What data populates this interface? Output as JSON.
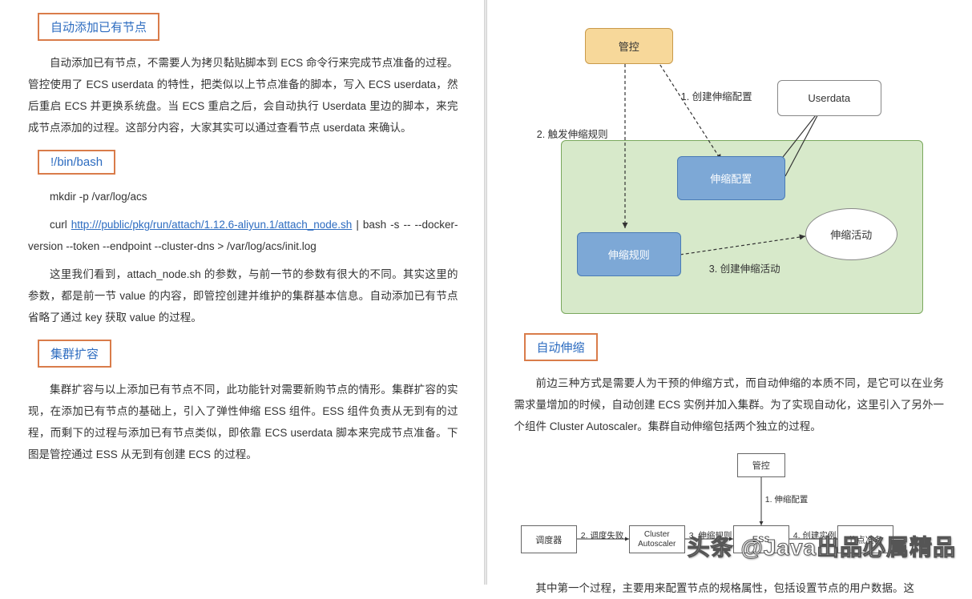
{
  "left": {
    "heading1": "自动添加已有节点",
    "para1": "自动添加已有节点，不需要人为拷贝黏贴脚本到 ECS 命令行来完成节点准备的过程。管控使用了 ECS userdata 的特性，把类似以上节点准备的脚本，写入 ECS userdata，然后重启 ECS 并更换系统盘。当 ECS 重启之后，会自动执行 Userdata 里边的脚本，来完成节点添加的过程。这部分内容，大家其实可以通过查看节点 userdata 来确认。",
    "heading2": "!/bin/bash",
    "code1": "mkdir -p /var/log/acs",
    "code2_prefix": "curl ",
    "code2_link": "http:///public/pkg/run/attach/1.12.6-aliyun.1/attach_node.sh",
    "code2_suffix": " | bash -s -- --docker-version --token --endpoint --cluster-dns > /var/log/acs/init.log",
    "para2": "这里我们看到，attach_node.sh 的参数，与前一节的参数有很大的不同。其实这里的参数，都是前一节 value 的内容，即管控创建并维护的集群基本信息。自动添加已有节点省略了通过 key 获取 value 的过程。",
    "heading3": "集群扩容",
    "para3": "集群扩容与以上添加已有节点不同，此功能针对需要新购节点的情形。集群扩容的实现，在添加已有节点的基础上，引入了弹性伸缩 ESS 组件。ESS 组件负责从无到有的过程，而剩下的过程与添加已有节点类似，即依靠 ECS userdata 脚本来完成节点准备。下图是管控通过 ESS 从无到有创建 ECS 的过程。"
  },
  "right": {
    "diagram_top": {
      "box_control": "管控",
      "box_userdata": "Userdata",
      "box_scale_config": "伸缩配置",
      "box_scale_rule": "伸缩规则",
      "box_scale_activity": "伸缩活动",
      "label1": "1. 创建伸缩配置",
      "label2": "2. 触发伸缩规则",
      "label3": "3. 创建伸缩活动"
    },
    "heading1": "自动伸缩",
    "para1": "前边三种方式是需要人为干预的伸缩方式，而自动伸缩的本质不同，是它可以在业务需求量增加的时候，自动创建 ECS 实例并加入集群。为了实现自动化，这里引入了另外一个组件 Cluster Autoscaler。集群自动伸缩包括两个独立的过程。",
    "diagram_bottom": {
      "box_control": "管控",
      "box_scheduler": "调度器",
      "box_autoscaler": "Cluster Autoscaler",
      "box_ess": "ESS",
      "box_node": "节点准备",
      "label1": "1. 伸缩配置",
      "label2": "2. 调度失败",
      "label3": "3. 伸缩规则",
      "label4": "4. 创建实例"
    },
    "para2": "其中第一个过程，主要用来配置节点的规格属性，包括设置节点的用户数据。这",
    "watermark": "头条 @Java出品必属精品"
  }
}
